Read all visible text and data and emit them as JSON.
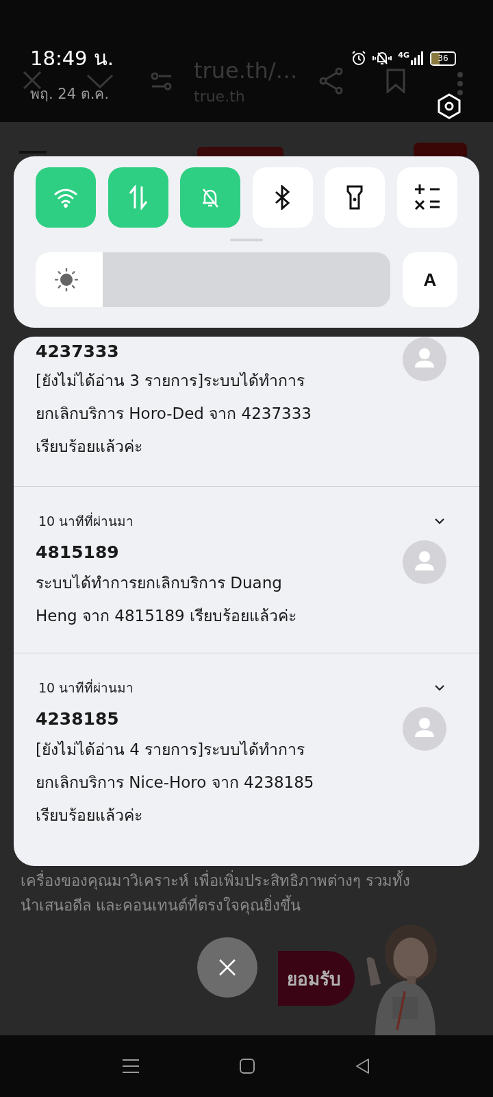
{
  "status_bar": {
    "time": "18:49 น.",
    "date": "พฤ. 24 ต.ค.",
    "network": "4G",
    "battery": "36"
  },
  "browser_toolbar": {
    "url": "true.th/…",
    "domain": "true.th"
  },
  "quick_tiles": [
    {
      "kind": "wifi",
      "on": true
    },
    {
      "kind": "data",
      "on": true
    },
    {
      "kind": "mute",
      "on": true
    },
    {
      "kind": "bluetooth",
      "on": false
    },
    {
      "kind": "flashlight",
      "on": false
    },
    {
      "kind": "calculator",
      "on": false
    }
  ],
  "brightness": {
    "level": 0.19,
    "auto_label": "A"
  },
  "notifications": [
    {
      "sender": "4237333",
      "body": "[ยังไม่ได้อ่าน 3 รายการ]ระบบได้ทำการ\nยกเลิกบริการ Horo-Ded จาก 4237333\nเรียบร้อยแล้วค่ะ"
    },
    {
      "time": "10 นาทีที่ผ่านมา",
      "sender": "4815189",
      "body": "ระบบได้ทำการยกเลิกบริการ Duang\nHeng จาก 4815189 เรียบร้อยแล้วค่ะ"
    },
    {
      "time": "10 นาทีที่ผ่านมา",
      "sender": "4238185",
      "body": "[ยังไม่ได้อ่าน 4 รายการ]ระบบได้ทำการ\nยกเลิกบริการ Nice-Horo จาก 4238185\nเรียบร้อยแล้วค่ะ"
    }
  ],
  "page_behind": {
    "text_lines": [
      "เครื่องของคุณมาวิเคราะห์ เพื่อเพิ่มประสิทธิภาพต่างๆ รวมทั้ง",
      "นำเสนอดีล และคอนเทนต์ที่ตรงใจคุณยิ่งขึ้น"
    ],
    "button": "ยอมรับ"
  }
}
